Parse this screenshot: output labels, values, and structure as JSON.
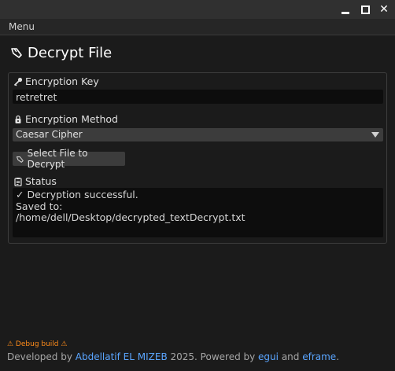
{
  "window_controls": {
    "close_glyph": "✕"
  },
  "menubar": {
    "menu_label": "Menu"
  },
  "page": {
    "title": "Decrypt File"
  },
  "form": {
    "key_label": "Encryption Key",
    "key_value": "retretret",
    "method_label": "Encryption Method",
    "method_value": "Caesar Cipher",
    "select_file_label": "Select File to Decrypt",
    "status_label": "Status",
    "status_text": "✓ Decryption successful.\nSaved to:\n/home/dell/Desktop/decrypted_textDecrypt.txt"
  },
  "footer": {
    "debug_build": "⚠ Debug build ⚠",
    "developed_by": "Developed by ",
    "author": "Abdellatif EL MIZEB",
    "year_powered": " 2025. Powered by ",
    "egui": "egui",
    "and": " and ",
    "eframe": "eframe",
    "period": "."
  },
  "colors": {
    "background": "#1b1b1b",
    "link": "#5aa5ff",
    "warning": "#ff8c1a"
  },
  "icons": {
    "title": "hand-pointing-icon",
    "key": "key-icon",
    "method": "lock-icon",
    "select_file": "hand-pointing-icon",
    "status": "clipboard-icon"
  }
}
